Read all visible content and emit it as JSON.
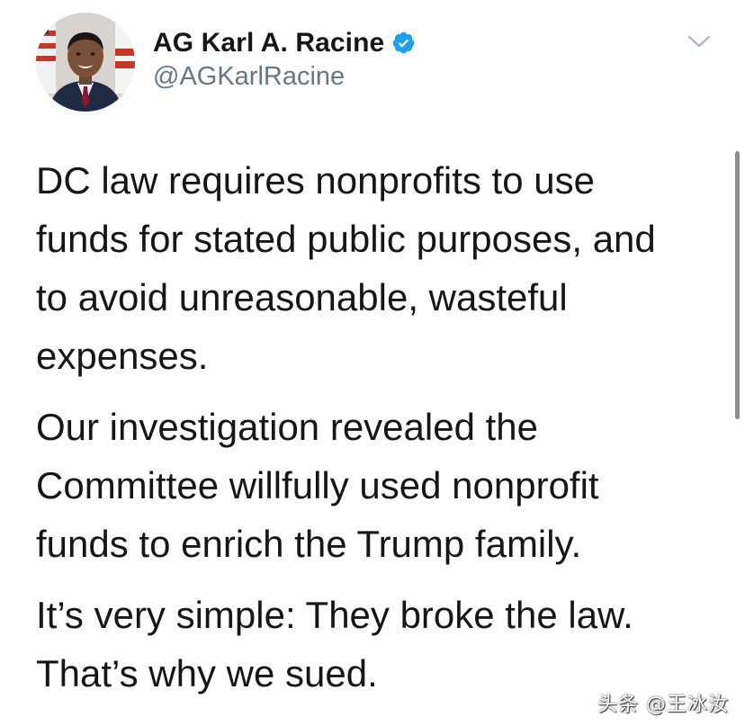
{
  "tweet": {
    "author": {
      "display_name": "AG Karl A. Racine",
      "handle": "@AGKarlRacine",
      "verified": true,
      "verified_icon": "verified-badge-icon"
    },
    "menu_icon": "chevron-down-icon",
    "paragraphs": [
      "DC law requires nonprofits to use\nfunds for stated public purposes, and\nto avoid unreasonable, wasteful\nexpenses.",
      "Our investigation revealed the\nCommittee willfully used nonprofit\nfunds to enrich the Trump family.",
      "It’s very simple: They broke the law.\nThat’s why we sued."
    ]
  },
  "watermark": "头条 @王冰汝",
  "colors": {
    "text": "#14171a",
    "secondary": "#657786",
    "verified_blue": "#1da1f2",
    "background": "#ffffff"
  }
}
